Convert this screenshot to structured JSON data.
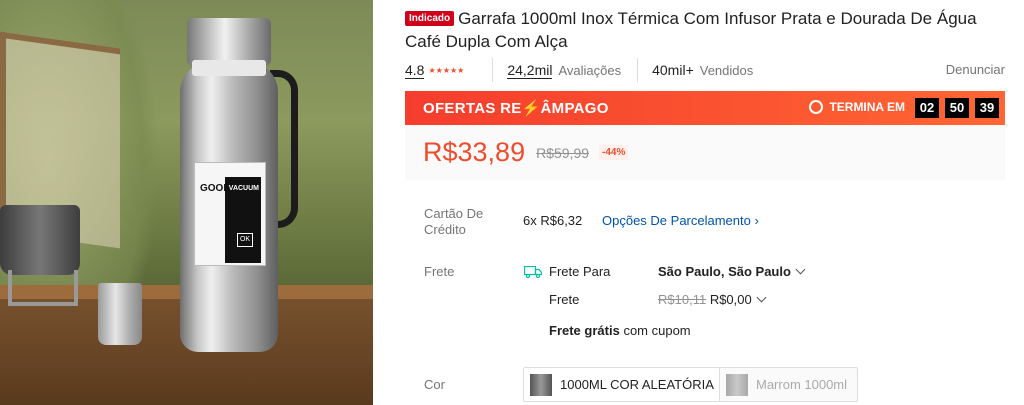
{
  "product": {
    "badge": "Indicado",
    "title": "Garrafa 1000ml Inox Térmica Com Infusor Prata e Dourada De Água Café Dupla Com Alça",
    "image_label_brand": "GOOD",
    "image_label_vacuum": "VACUUM",
    "image_label_ok": "OK"
  },
  "stats": {
    "rating": "4.8",
    "stars": "★★★★★",
    "reviews_count": "24,2mil",
    "reviews_label": "Avaliações",
    "sold_count": "40mil+",
    "sold_label": "Vendidos",
    "report": "Denunciar"
  },
  "flash_sale": {
    "title_part1": "OFERTAS RE",
    "bolt": "⚡",
    "title_part2": "ÂMPAGO",
    "ends_label": "TERMINA EM",
    "timer": [
      "02",
      "50",
      "39"
    ]
  },
  "price": {
    "current": "R$33,89",
    "original": "R$59,99",
    "discount": "-44%"
  },
  "installments": {
    "label": "Cartão De Crédito",
    "value": "6x R$6,32",
    "link": "Opções De Parcelamento"
  },
  "shipping": {
    "label": "Frete",
    "to_label": "Frete Para",
    "destination": "São Paulo, São Paulo",
    "fee_label": "Frete",
    "fee_original": "R$10,11",
    "fee_current": "R$0,00",
    "free_bold": "Frete grátis",
    "free_rest": "com cupom"
  },
  "variants": {
    "label": "Cor",
    "options": [
      "1000ML COR ALEATÓRIA",
      "Marrom 1000ml"
    ]
  },
  "colors": {
    "accent": "#ee4d2d",
    "link": "#0055aa"
  }
}
